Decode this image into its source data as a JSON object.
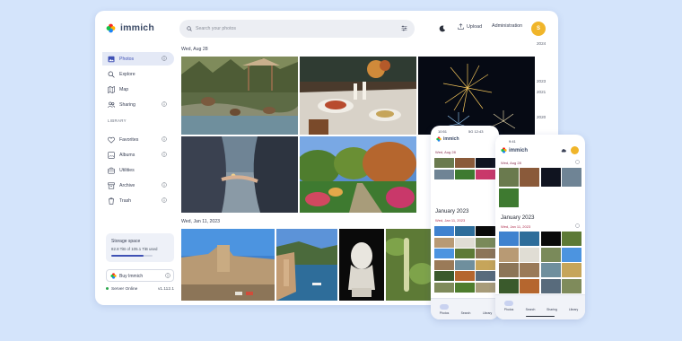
{
  "app": {
    "name": "immich"
  },
  "header": {
    "search_placeholder": "Search your photos",
    "upload_label": "Upload",
    "admin_label": "Administration",
    "avatar_initial": "S"
  },
  "sidebar": {
    "items": [
      {
        "label": "Photos",
        "icon": "photos-icon",
        "active": true,
        "info": true
      },
      {
        "label": "Explore",
        "icon": "explore-icon",
        "active": false,
        "info": false
      },
      {
        "label": "Map",
        "icon": "map-icon",
        "active": false,
        "info": false
      },
      {
        "label": "Sharing",
        "icon": "sharing-icon",
        "active": false,
        "info": true
      }
    ],
    "library_title": "LIBRARY",
    "library_items": [
      {
        "label": "Favorites",
        "icon": "favorite-icon",
        "info": true
      },
      {
        "label": "Albums",
        "icon": "albums-icon",
        "info": true
      },
      {
        "label": "Utilities",
        "icon": "utilities-icon",
        "info": false
      },
      {
        "label": "Archive",
        "icon": "archive-icon",
        "info": true
      },
      {
        "label": "Trash",
        "icon": "trash-icon",
        "info": true
      }
    ],
    "storage": {
      "title": "Storage space",
      "usage": "82.8 TiB of 105.1 TiB used",
      "fraction": 0.79
    },
    "buy_label": "Buy Immich",
    "server_status": "Server Online",
    "version": "v1.112.1"
  },
  "timeline": {
    "groups": [
      {
        "date": "Wed, Aug 28"
      },
      {
        "date": "Wed, Jan 11, 2023"
      }
    ],
    "scrubber_years": [
      "2024",
      "2023",
      "2021",
      "2020"
    ]
  },
  "phone_back": {
    "status_time": "10:51",
    "status_right": "5G 12:43",
    "app_name": "immich",
    "first_date": "Wed, Aug 28",
    "month_title": "January 2023",
    "second_date": "Wed, Jan 11, 2023",
    "nav": [
      "Photos",
      "Search",
      "Library"
    ]
  },
  "phone_front": {
    "status_time": "9:41",
    "app_name": "immich",
    "first_date": "Wed, Aug 28",
    "month_title": "January 2023",
    "second_date": "Wed, Jan 11, 2023",
    "nav": [
      "Photos",
      "Search",
      "Sharing",
      "Library"
    ]
  },
  "colors": {
    "background": "#d4e4fb",
    "accent": "#3f51b5",
    "avatar": "#f0b52a",
    "online": "#2fa84f"
  }
}
